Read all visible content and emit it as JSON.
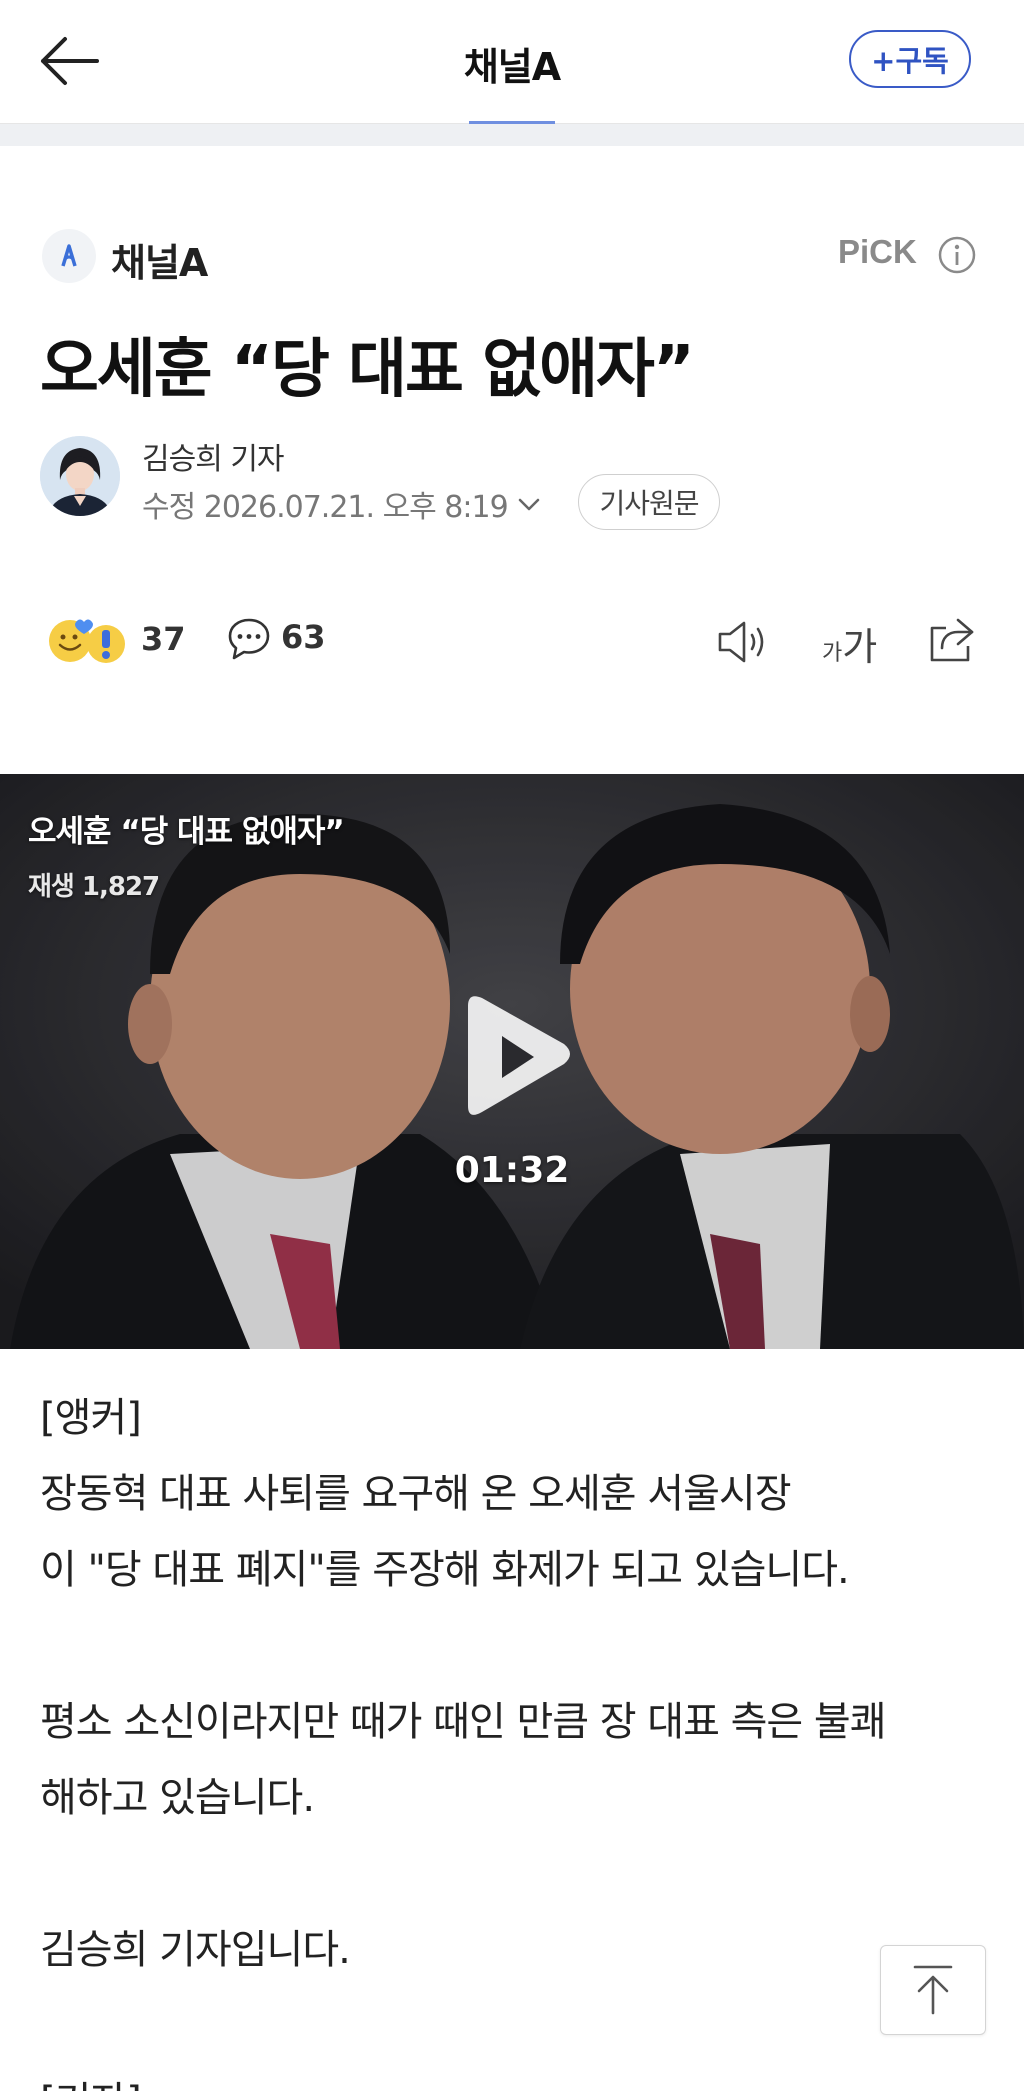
{
  "topbar": {
    "title": "채널A",
    "subscribe_label": "+구독"
  },
  "press": {
    "name": "채널A",
    "pick_label": "PiCK"
  },
  "article": {
    "headline": "오세훈 “당 대표 없애자”",
    "reporter_name": "김승희 기자",
    "date_text": "수정 2026.07.21. 오후 8:19",
    "original_label": "기사원문"
  },
  "reactions": {
    "reaction_count": "37",
    "comment_count": "63",
    "font_small": "가",
    "font_big": "가"
  },
  "video": {
    "title": "오세훈 “당 대표 없애자”",
    "plays": "재생 1,827",
    "duration": "01:32"
  },
  "body": {
    "p1": "[앵커]",
    "p2": "장동혁 대표 사퇴를 요구해 온 오세훈 서울시장",
    "p3": "이 \"당 대표 폐지\"를 주장해 화제가 되고 있습니다.",
    "p4": "평소 소신이라지만 때가 때인 만큼 장 대표 측은 불쾌",
    "p5": "해하고 있습니다.",
    "p6": "김승희 기자입니다.",
    "p7": "[기자]"
  },
  "colors": {
    "accent": "#2f53c2",
    "video_bg": "#2a2a2e"
  }
}
